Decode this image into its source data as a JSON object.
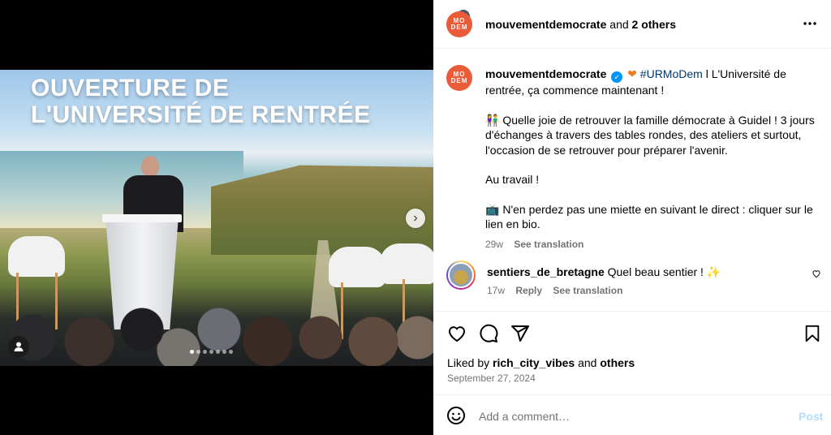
{
  "media": {
    "headline_line1": "OUVERTURE DE",
    "headline_line2": "L'UNIVERSITÉ DE RENTRÉE",
    "carousel_dot_count": 7,
    "carousel_active_index": 0,
    "next_icon": "chevron-right-icon",
    "tag_icon": "user-tag-icon"
  },
  "header": {
    "username": "mouvementdemocrate",
    "and_text": " and ",
    "others": "2 others",
    "avatar_text_1": "MO",
    "avatar_text_2": "DEM",
    "more_icon": "more-horizontal-icon"
  },
  "caption": {
    "username": "mouvementdemocrate",
    "hashtag": "#URMoDem",
    "line1_rest": " l L'Université de rentrée, ça commence maintenant !",
    "para2_emoji": "👫",
    "para2": " Quelle joie de retrouver la famille démocrate à Guidel ! 3 jours d'échanges à travers des tables rondes, des ateliers et surtout, l'occasion de se retrouver pour préparer l'avenir.",
    "para3": "Au travail !",
    "para4_emoji": "📺",
    "para4": " N'en perdez pas une miette en suivant le direct : cliquer sur le lien en bio.",
    "age": "29w",
    "see_translation": "See translation"
  },
  "comment": {
    "username": "sentiers_de_bretagne",
    "text": " Quel beau sentier ! ",
    "emoji": "✨",
    "age": "17w",
    "reply": "Reply",
    "see_translation": "See translation"
  },
  "actions": {
    "liked_by_prefix": "Liked by ",
    "liked_by_user": "rich_city_vibes",
    "liked_and": " and ",
    "liked_others": "others",
    "date": "September 27, 2024"
  },
  "composer": {
    "placeholder": "Add a comment…",
    "post_label": "Post"
  },
  "colors": {
    "brand_orange": "#ea5b39",
    "link_blue": "#00376b",
    "verified_blue": "#0095f6",
    "post_disabled": "#b3dbff"
  }
}
